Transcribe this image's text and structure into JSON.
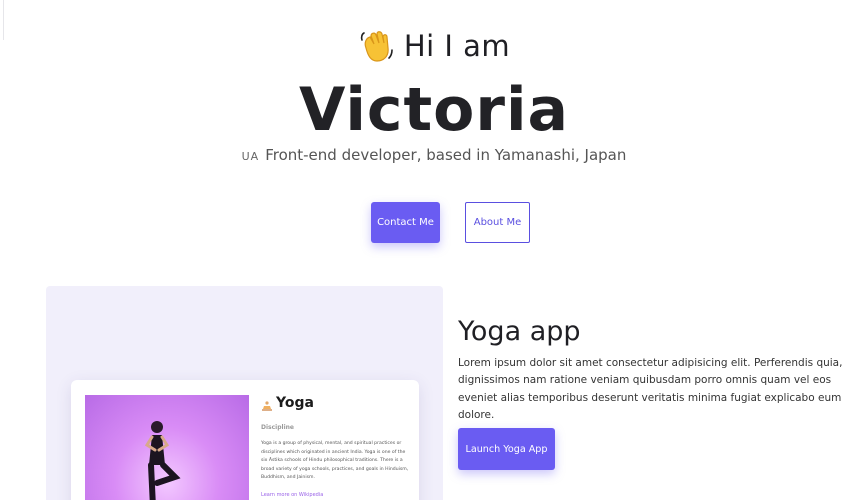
{
  "hero": {
    "greeting": "Hi I am",
    "greeting_icon": "waving-hand-icon",
    "name": "Victoria",
    "flag": "UA",
    "subtitle": "Front-end developer, based in Yamanashi, Japan"
  },
  "actions": {
    "contact_label": "Contact Me",
    "about_label": "About Me"
  },
  "project": {
    "title": "Yoga app",
    "description": "Lorem ipsum dolor sit amet consectetur adipisicing elit. Perferendis quia, dignissimos nam ratione veniam quibusdam porro omnis quam vel eos eveniet alias temporibus deserunt veritatis minima fugiat explicabo eum dolore.",
    "launch_label": "Launch Yoga App",
    "preview": {
      "brand_icon": "lotus-icon",
      "title": "Yoga",
      "section": "Discipline",
      "text": "Yoga is a group of physical, mental, and spiritual practices or disciplines which originated in ancient India. Yoga is one of the six Āstika schools of Hindu philosophical traditions. There is a broad variety of yoga schools, practices, and goals in Hinduism, Buddhism, and Jainism.",
      "link": "Learn more on Wikipedia"
    }
  },
  "colors": {
    "accent": "#6a5cf2",
    "card_bg": "#f1effb",
    "text": "#222226"
  }
}
